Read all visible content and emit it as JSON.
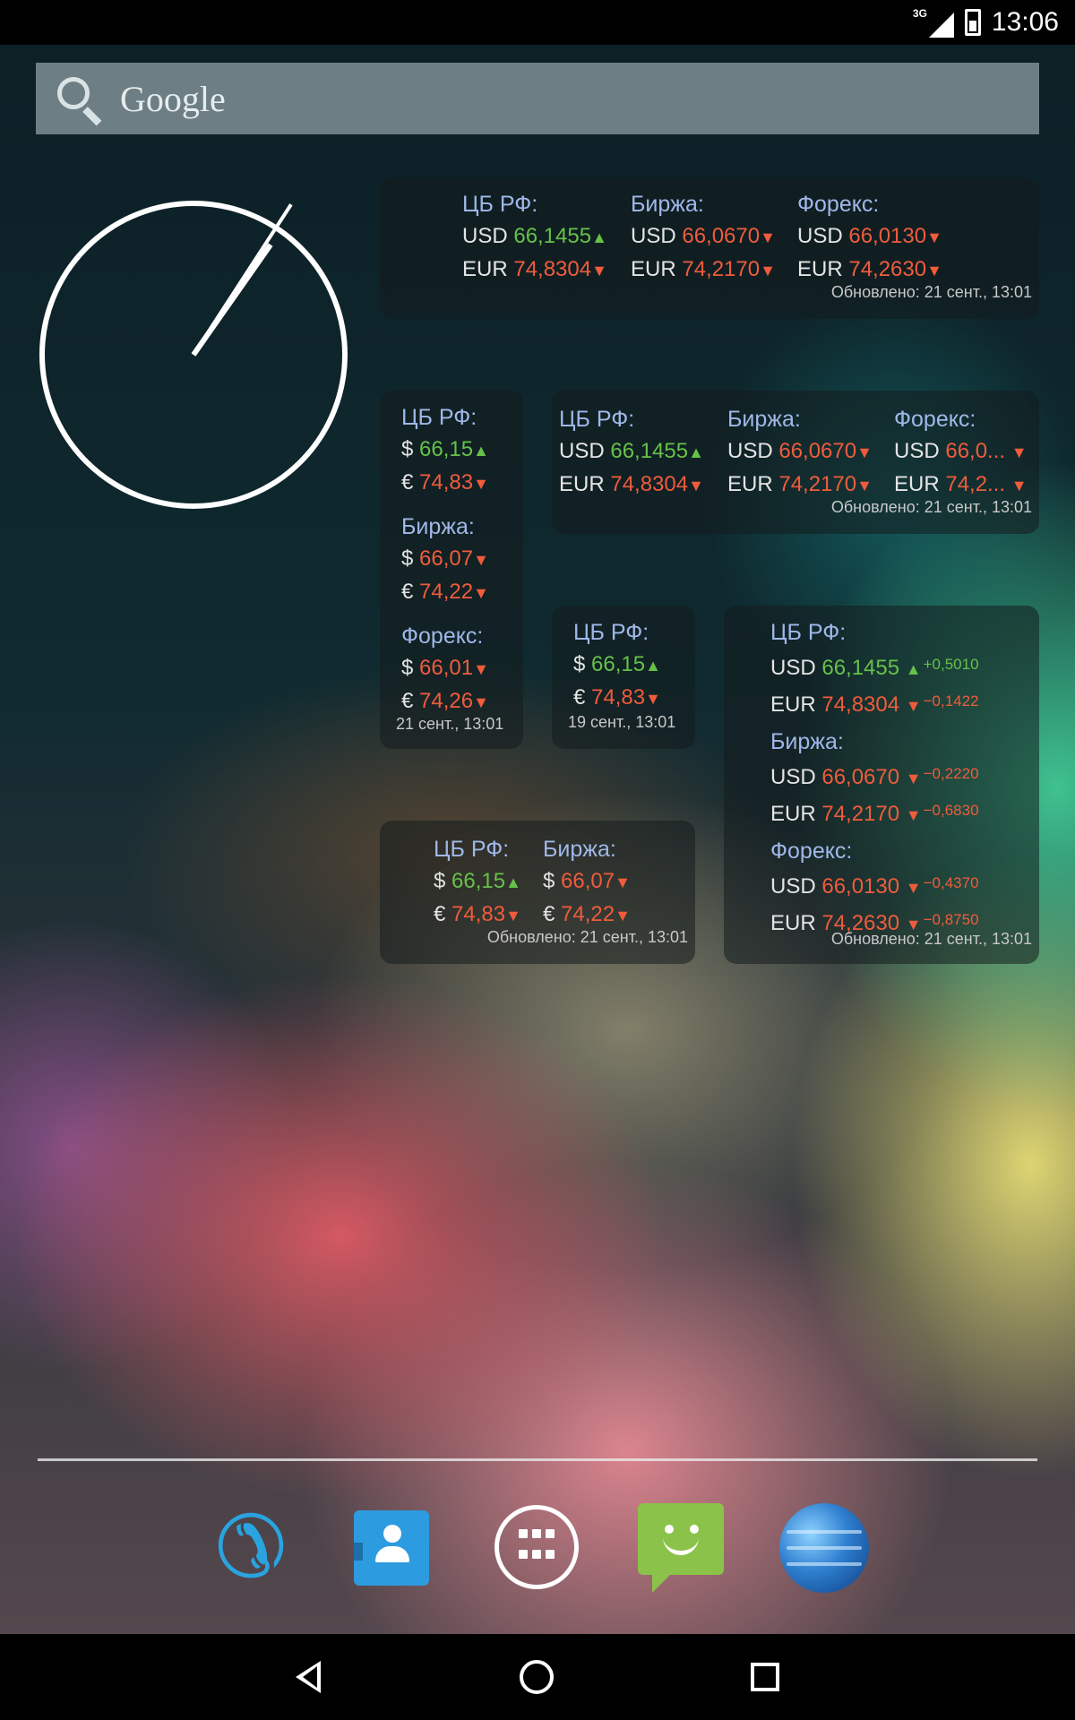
{
  "status_bar": {
    "network": "3G",
    "time": "13:06"
  },
  "search": {
    "label": "Google"
  },
  "labels": {
    "usd": "USD",
    "eur": "EUR",
    "usd_sym": "$",
    "eur_sym": "€"
  },
  "arrows": {
    "up": "▲",
    "down": "▼"
  },
  "headers": {
    "cb": "ЦБ РФ:",
    "exchange": "Биржа:",
    "forex": "Форекс:"
  },
  "widget_wide": {
    "cb": {
      "usd": "66,1455",
      "eur": "74,8304"
    },
    "exchange": {
      "usd": "66,0670",
      "eur": "74,2170"
    },
    "forex": {
      "usd": "66,0130",
      "eur": "74,2630"
    },
    "updated": "Обновлено: 21 сент., 13:01"
  },
  "widget_wide2": {
    "cb": {
      "usd": "66,1455",
      "eur": "74,8304"
    },
    "exchange": {
      "usd": "66,0670",
      "eur": "74,2170"
    },
    "forex": {
      "usd": "66,0...",
      "eur": "74,2..."
    },
    "updated": "Обновлено: 21 сент., 13:01"
  },
  "widget_tall": {
    "cb": {
      "usd": "66,15",
      "eur": "74,83"
    },
    "exchange": {
      "usd": "66,07",
      "eur": "74,22"
    },
    "forex": {
      "usd": "66,01",
      "eur": "74,26"
    },
    "updated": "21 сент., 13:01"
  },
  "widget_small": {
    "cb": {
      "usd": "66,15",
      "eur": "74,83"
    },
    "updated": "19 сент., 13:01"
  },
  "widget_detail": {
    "cb": {
      "usd": "66,1455",
      "usd_delta": "+0,5010",
      "eur": "74,8304",
      "eur_delta": "−0,1422"
    },
    "exchange": {
      "usd": "66,0670",
      "usd_delta": "−0,2220",
      "eur": "74,2170",
      "eur_delta": "−0,6830"
    },
    "forex": {
      "usd": "66,0130",
      "usd_delta": "−0,4370",
      "eur": "74,2630",
      "eur_delta": "−0,8750"
    },
    "updated": "Обновлено: 21 сент., 13:01"
  },
  "widget_medium": {
    "cb": {
      "usd": "66,15",
      "eur": "74,83"
    },
    "exchange": {
      "usd": "66,07",
      "eur": "74,22"
    },
    "updated": "Обновлено: 21 сент., 13:01"
  },
  "dock": {
    "icons": [
      "phone-icon",
      "contacts-icon",
      "app-drawer-icon",
      "messenger-icon",
      "browser-icon"
    ]
  },
  "colors": {
    "up": "#66c14a",
    "down": "#ef5c3c",
    "header": "#9fb8e8"
  }
}
